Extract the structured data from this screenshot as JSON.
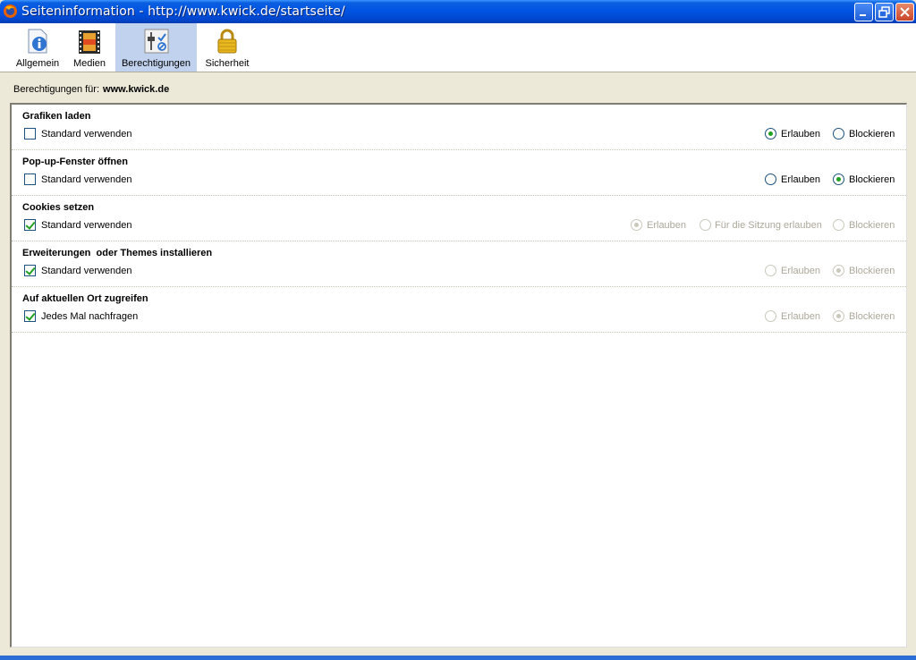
{
  "window": {
    "title": "Seiteninformation - http://www.kwick.de/startseite/"
  },
  "toolbar": {
    "tabs": [
      {
        "label": "Allgemein",
        "icon": "info-page-icon"
      },
      {
        "label": "Medien",
        "icon": "media-film-icon"
      },
      {
        "label": "Berechtigungen",
        "icon": "permissions-sliders-icon",
        "selected": true
      },
      {
        "label": "Sicherheit",
        "icon": "padlock-icon"
      }
    ]
  },
  "permissions_for": {
    "label": "Berechtigungen für:",
    "host": "www.kwick.de"
  },
  "sections": [
    {
      "title": "Grafiken laden",
      "checkbox": {
        "label": "Standard verwenden",
        "checked": false
      },
      "options": [
        {
          "label": "Erlauben",
          "selected": true,
          "enabled": true
        },
        {
          "label": "Blockieren",
          "selected": false,
          "enabled": true
        }
      ]
    },
    {
      "title": "Pop-up-Fenster öffnen",
      "checkbox": {
        "label": "Standard verwenden",
        "checked": false
      },
      "options": [
        {
          "label": "Erlauben",
          "selected": false,
          "enabled": true
        },
        {
          "label": "Blockieren",
          "selected": true,
          "enabled": true
        }
      ]
    },
    {
      "title": "Cookies setzen",
      "checkbox": {
        "label": "Standard verwenden",
        "checked": true
      },
      "options": [
        {
          "label": "Erlauben",
          "selected": true,
          "enabled": false
        },
        {
          "label": "Für die Sitzung erlauben",
          "selected": false,
          "enabled": false
        },
        {
          "label": "Blockieren",
          "selected": false,
          "enabled": false
        }
      ]
    },
    {
      "title": "Erweiterungen  oder Themes installieren",
      "checkbox": {
        "label": "Standard verwenden",
        "checked": true
      },
      "options": [
        {
          "label": "Erlauben",
          "selected": false,
          "enabled": false
        },
        {
          "label": "Blockieren",
          "selected": true,
          "enabled": false
        }
      ]
    },
    {
      "title": "Auf aktuellen Ort zugreifen",
      "checkbox": {
        "label": "Jedes Mal nachfragen",
        "checked": true
      },
      "options": [
        {
          "label": "Erlauben",
          "selected": false,
          "enabled": false
        },
        {
          "label": "Blockieren",
          "selected": true,
          "enabled": false
        }
      ]
    }
  ],
  "colors": {
    "titlebar": "#0054e3",
    "selected_tab": "#c1d2ee",
    "check_green": "#21a121"
  }
}
